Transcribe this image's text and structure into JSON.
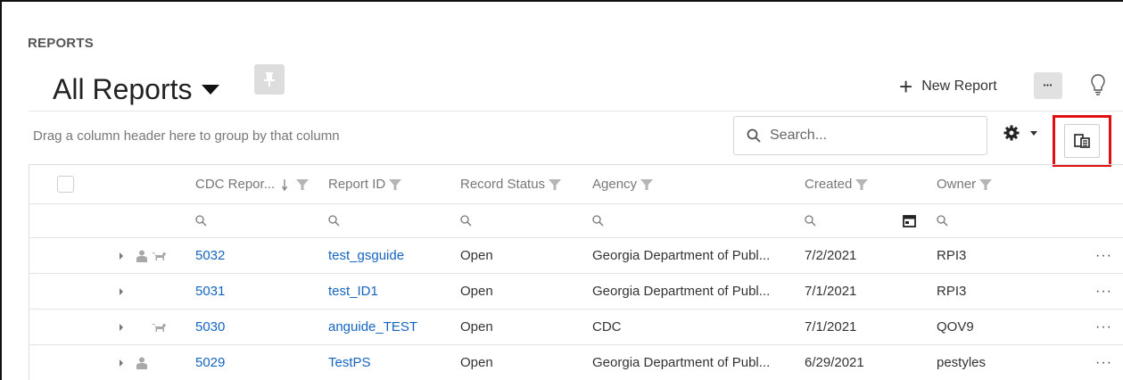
{
  "header": {
    "section_label": "REPORTS",
    "title": "All Reports",
    "new_report_label": "New Report",
    "more_label": "•••"
  },
  "toolbar": {
    "group_hint": "Drag a column header here to group by that column",
    "search_placeholder": "Search..."
  },
  "columns": [
    {
      "key": "cdc_report",
      "label": "CDC Repor...",
      "sort": "descending",
      "filter": true
    },
    {
      "key": "report_id",
      "label": "Report ID",
      "filter": true
    },
    {
      "key": "record_status",
      "label": "Record Status",
      "filter": true
    },
    {
      "key": "agency",
      "label": "Agency",
      "filter": true
    },
    {
      "key": "created",
      "label": "Created",
      "filter": true
    },
    {
      "key": "owner",
      "label": "Owner",
      "filter": true
    }
  ],
  "rows": [
    {
      "icons": [
        "person-icon",
        "dog-icon"
      ],
      "cdc_report": "5032",
      "report_id": "test_gsguide",
      "record_status": "Open",
      "agency": "Georgia Department of Publ...",
      "created": "7/2/2021",
      "owner": "RPI3",
      "actions": "···"
    },
    {
      "icons": [],
      "cdc_report": "5031",
      "report_id": "test_ID1",
      "record_status": "Open",
      "agency": "Georgia Department of Publ...",
      "created": "7/1/2021",
      "owner": "RPI3",
      "actions": "···"
    },
    {
      "icons": [
        "dog-icon"
      ],
      "cdc_report": "5030",
      "report_id": "anguide_TEST",
      "record_status": "Open",
      "agency": "CDC",
      "created": "7/1/2021",
      "owner": "QOV9",
      "actions": "···"
    },
    {
      "icons": [
        "person-icon"
      ],
      "cdc_report": "5029",
      "report_id": "TestPS",
      "record_status": "Open",
      "agency": "Georgia Department of Publ...",
      "created": "6/29/2021",
      "owner": "pestyles",
      "actions": "···"
    }
  ],
  "colors": {
    "link": "#1565c0",
    "highlight": "#e01010",
    "muted_icon": "#a0a0a0"
  }
}
